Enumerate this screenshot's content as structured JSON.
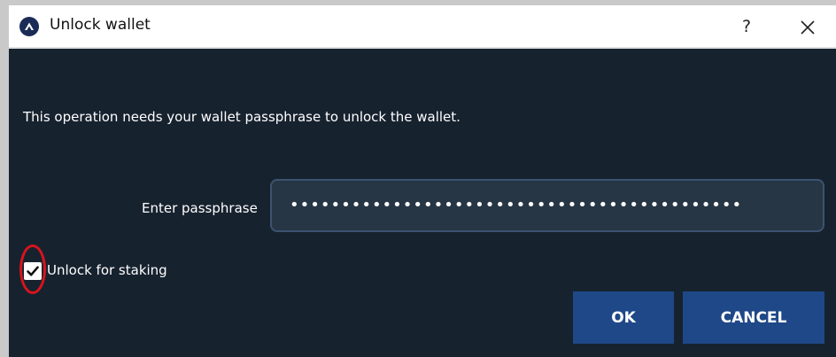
{
  "window": {
    "title": "Unlock wallet",
    "help_label": "?",
    "app_icon": "app-logo-icon",
    "close_icon": "close-icon"
  },
  "dialog": {
    "message": "This operation needs your wallet passphrase to unlock the wallet.",
    "passphrase_label": "Enter passphrase",
    "passphrase_value": "••••••••••••••••••••••••••••••••••••••••••••",
    "staking_checkbox": {
      "label": "Unlock for staking",
      "checked": true,
      "highlight_color": "#d8141c"
    }
  },
  "buttons": {
    "ok_label": "OK",
    "cancel_label": "CANCEL"
  },
  "colors": {
    "background": "#17222f",
    "input_background": "#263645",
    "input_border": "#3c5370",
    "button": "#1f4888",
    "titlebar": "#ffffff"
  }
}
